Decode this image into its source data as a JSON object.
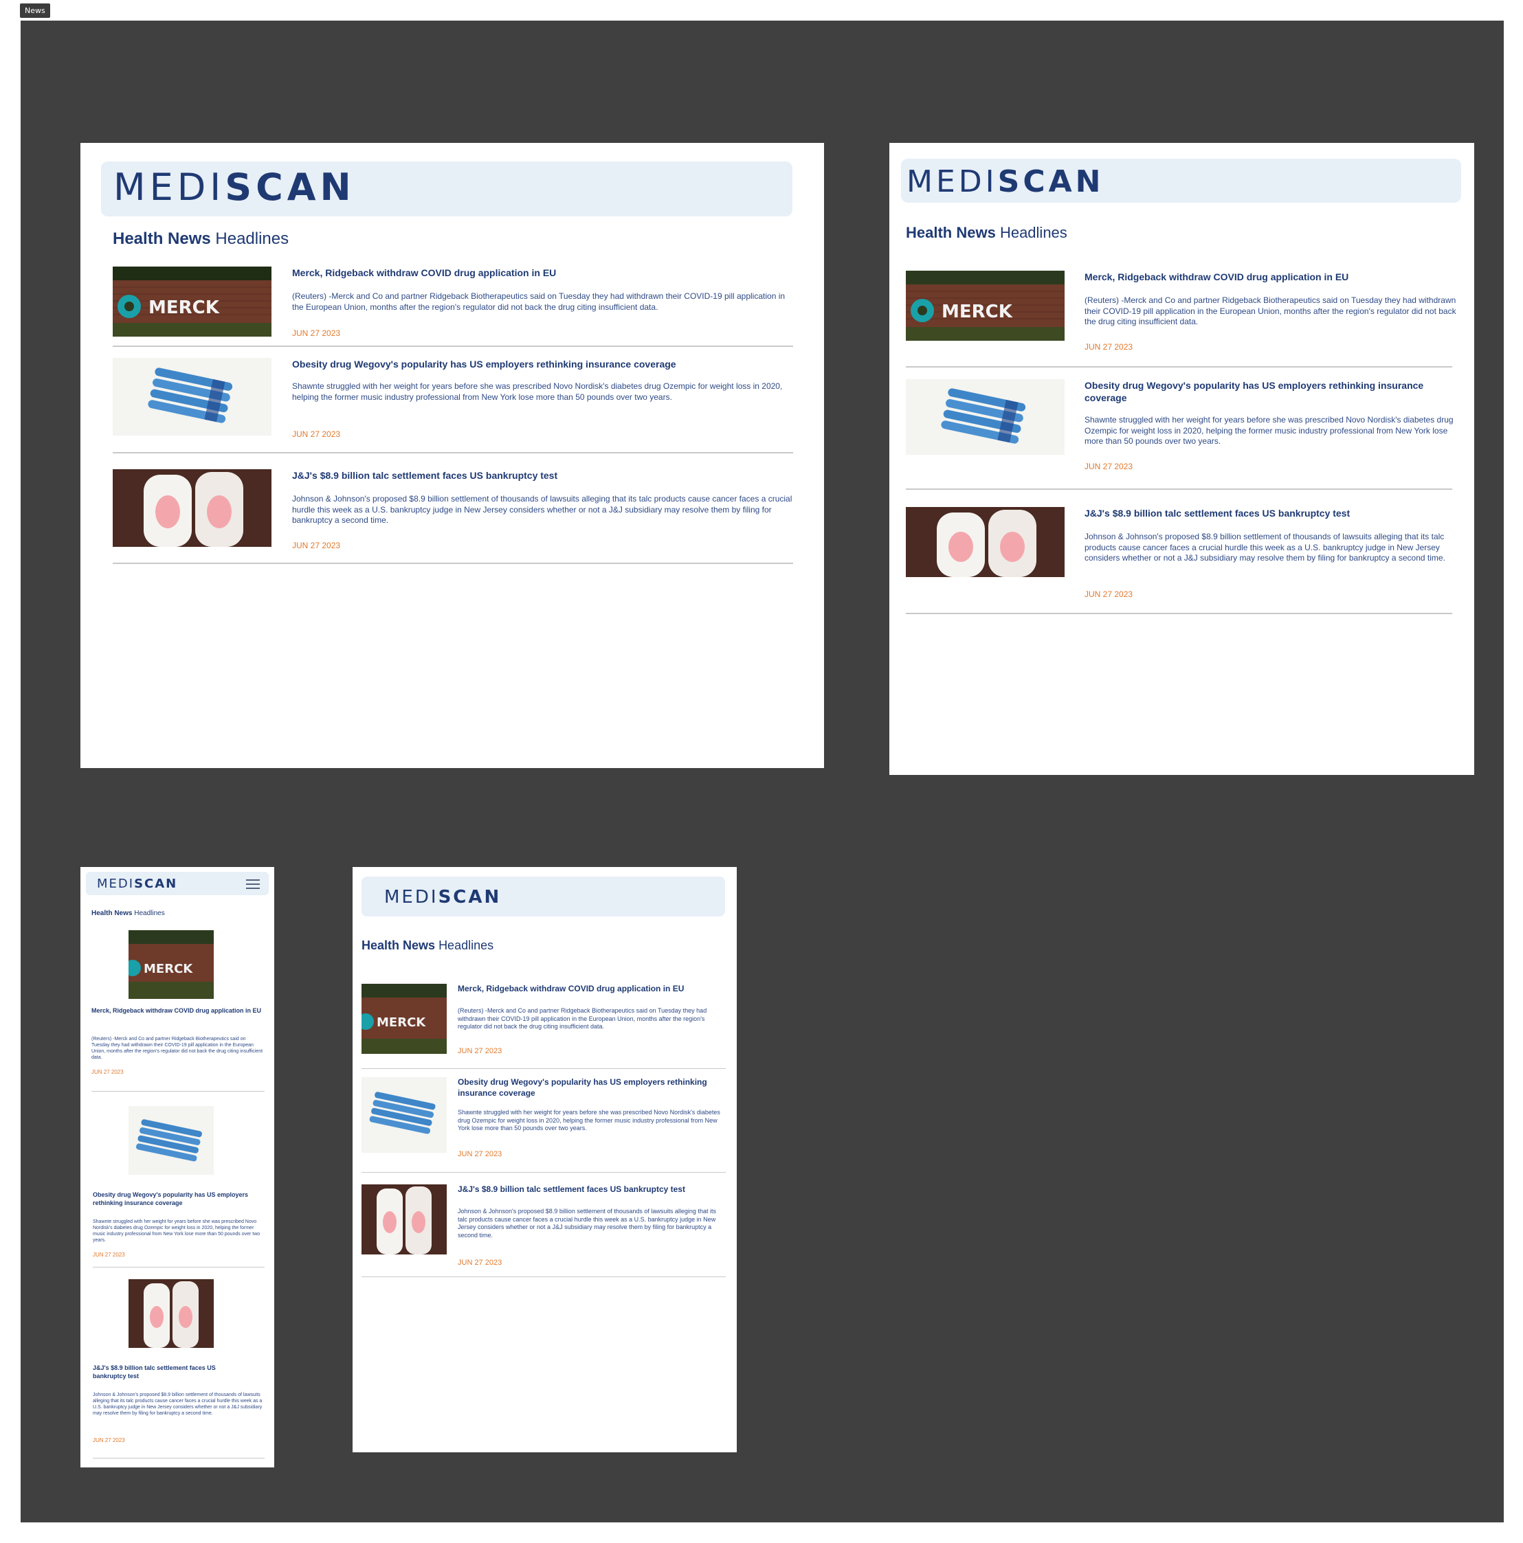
{
  "tab": {
    "label": "News"
  },
  "brand": {
    "light": "MEDI",
    "bold": "SCAN"
  },
  "heading": {
    "bold": "Health News",
    "light": "Headlines"
  },
  "articles": [
    {
      "title": "Merck, Ridgeback withdraw COVID drug application in EU",
      "description": "(Reuters) -Merck and Co and partner Ridgeback Biotherapeutics said on Tuesday they had withdrawn their COVID-19 pill application in the European Union, months after the region's regulator did not back the drug citing insufficient data.",
      "date": "JUN 27 2023",
      "image": "merck-sign-photo",
      "sign_text": "MERCK"
    },
    {
      "title": "Obesity drug Wegovy's popularity has US employers rethinking insurance coverage",
      "description": "Shawnte struggled with her weight for years before she was prescribed Novo Nordisk's diabetes drug Ozempic for weight loss in 2020, helping the former music industry professional from New York lose more than 50 pounds over two years.",
      "date": "JUN 27 2023",
      "image": "injection-pens-photo"
    },
    {
      "title": "J&J's $8.9 billion talc settlement faces US bankruptcy test",
      "description": "Johnson & Johnson's proposed $8.9 billion settlement of thousands of lawsuits alleging that its talc products cause cancer faces a crucial hurdle this week as a U.S. bankruptcy judge in New Jersey considers whether or not a J&J subsidiary may resolve them by filing for bankruptcy a second time.",
      "date": "JUN 27 2023",
      "image": "baby-powder-bottles-photo"
    }
  ],
  "colors": {
    "navy": "#1f3a73",
    "accent": "#e07a2e",
    "brand_bg": "#e7eff7",
    "canvas": "#404040"
  },
  "icons": {
    "menu": "hamburger-menu-icon"
  }
}
